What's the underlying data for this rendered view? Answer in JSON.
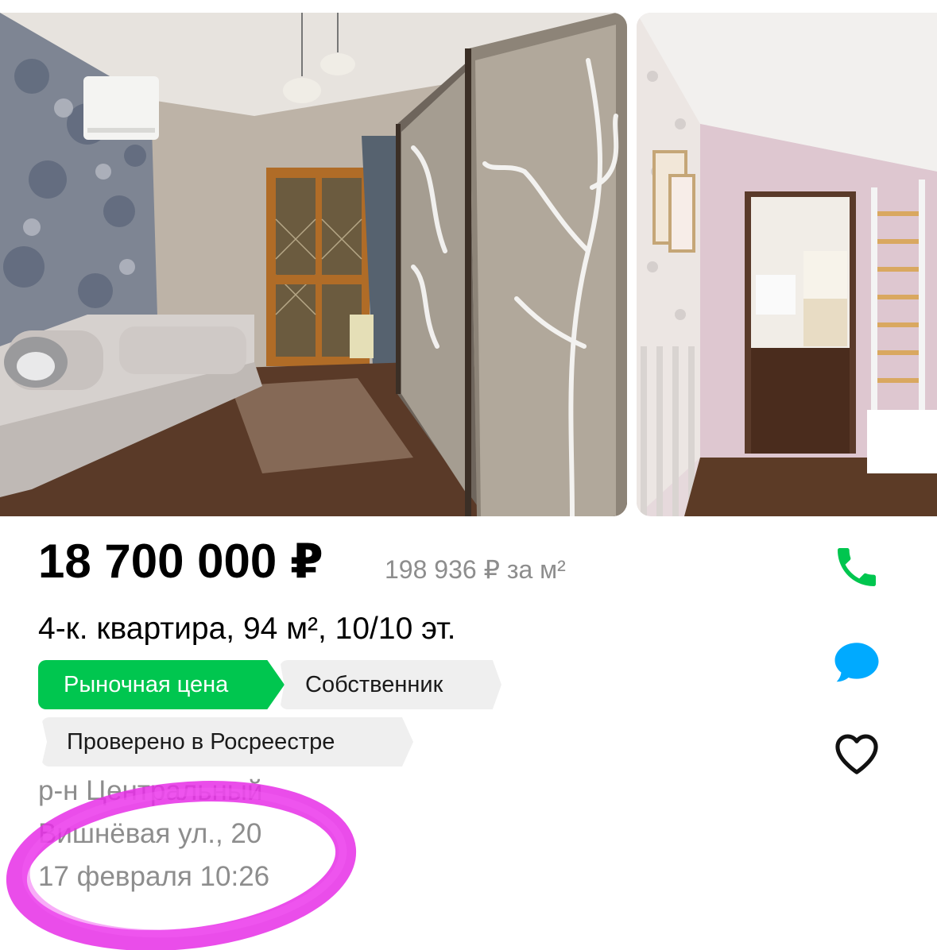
{
  "listing": {
    "price": "18 700 000 ₽",
    "price_per_m2": "198 936 ₽ за м²",
    "title": "4-к. квартира, 94 м², 10/10 эт.",
    "badges": [
      "Рыночная цена",
      "Собственник",
      "Проверено в Росреестре"
    ],
    "district": "р-н Центральный",
    "address": "Вишнёвая ул., 20",
    "published": "17 февраля 10:26"
  },
  "actions": {
    "call_icon": "phone-icon",
    "chat_icon": "chat-bubble-icon",
    "favorite_icon": "heart-icon"
  },
  "colors": {
    "market_badge": "#00c64f",
    "call_icon": "#00c64f",
    "chat_icon": "#00aaff",
    "annotation": "#e62ee6",
    "muted_text": "#8d8d8d"
  },
  "gallery": {
    "photos": [
      "living-room-photo",
      "nursery-photo"
    ]
  }
}
